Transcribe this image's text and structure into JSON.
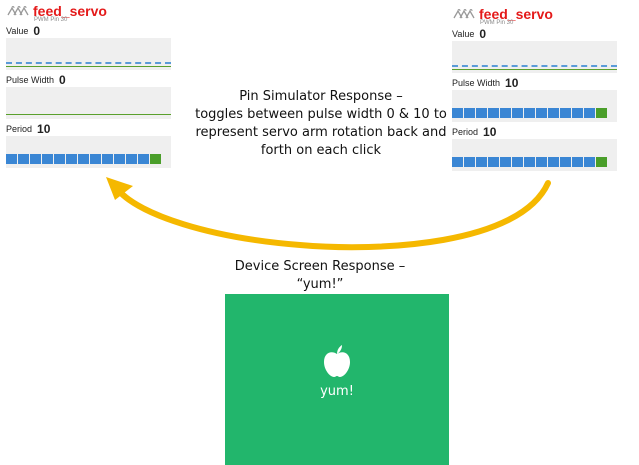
{
  "left_panel": {
    "title": "feed_servo",
    "subtitle": "PWM Pin 30",
    "value_label": "Value",
    "value": "0",
    "pulse_label": "Pulse Width",
    "pulse_value": "0",
    "period_label": "Period",
    "period_value": "10"
  },
  "right_panel": {
    "title": "feed_servo",
    "subtitle": "PWM Pin 30",
    "value_label": "Value",
    "value": "0",
    "pulse_label": "Pulse Width",
    "pulse_value": "10",
    "period_label": "Period",
    "period_value": "10"
  },
  "pin_simulator": {
    "line1": "Pin Simulator Response –",
    "line2": "toggles between pulse width 0 & 10 to",
    "line3": "represent servo arm rotation back and",
    "line4": "forth on each click"
  },
  "device_screen": {
    "line1": "Device Screen Response –",
    "line2": "“yum!”",
    "message": "yum!",
    "icon": "apple-icon",
    "background": "#22b66c"
  },
  "colors": {
    "title": "#e41a1a",
    "arrow": "#f5b800",
    "bar": "#3a86d4",
    "bar_end": "#4a9e2a"
  }
}
